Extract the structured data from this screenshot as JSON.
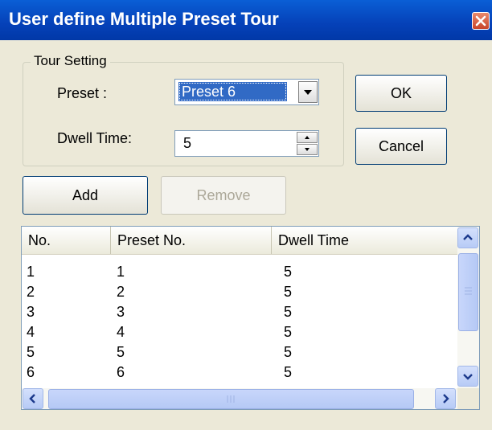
{
  "window": {
    "title": "User define Multiple Preset Tour"
  },
  "group": {
    "legend": "Tour Setting"
  },
  "preset": {
    "label": "Preset :",
    "value": "Preset 6"
  },
  "dwell": {
    "label": "Dwell Time:",
    "value": "5"
  },
  "buttons": {
    "ok": "OK",
    "cancel": "Cancel",
    "add": "Add",
    "remove": "Remove"
  },
  "list": {
    "headers": [
      "No.",
      "Preset No.",
      "Dwell Time"
    ],
    "rows": [
      [
        "1",
        "1",
        "5"
      ],
      [
        "2",
        "2",
        "5"
      ],
      [
        "3",
        "3",
        "5"
      ],
      [
        "4",
        "4",
        "5"
      ],
      [
        "5",
        "5",
        "5"
      ],
      [
        "6",
        "6",
        "5"
      ]
    ]
  },
  "icons": {
    "close": "close-icon",
    "dropdown": "chevron-down-icon",
    "spin_up": "spin-up-icon",
    "spin_down": "spin-down-icon",
    "scroll_up": "scroll-up-icon",
    "scroll_down": "scroll-down-icon",
    "scroll_left": "scroll-left-icon",
    "scroll_right": "scroll-right-icon"
  },
  "colors": {
    "titlebar": "#0541b8",
    "dialog_bg": "#ece9d8",
    "selection": "#316ac5",
    "close_button": "#c8442a"
  }
}
